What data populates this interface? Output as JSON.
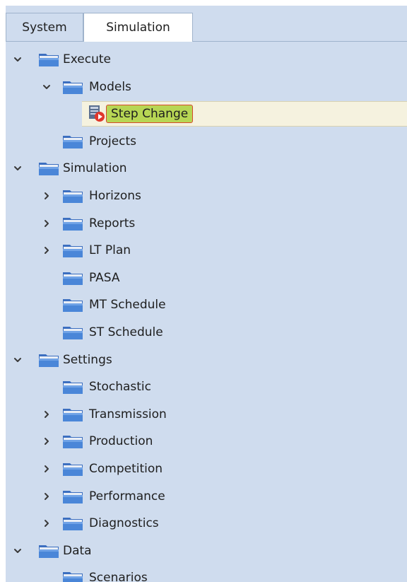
{
  "tabs": [
    {
      "label": "System",
      "active": false
    },
    {
      "label": "Simulation",
      "active": true
    }
  ],
  "tree": [
    {
      "label": "Execute",
      "level": 0,
      "expander": "expanded"
    },
    {
      "label": "Models",
      "level": 1,
      "expander": "expanded"
    },
    {
      "label": "Step Change",
      "level": 2,
      "expander": "none",
      "icon": "model-run-icon",
      "selected": true
    },
    {
      "label": "Projects",
      "level": 1,
      "expander": "none"
    },
    {
      "label": "Simulation",
      "level": 0,
      "expander": "expanded"
    },
    {
      "label": "Horizons",
      "level": 1,
      "expander": "collapsed"
    },
    {
      "label": "Reports",
      "level": 1,
      "expander": "collapsed"
    },
    {
      "label": "LT Plan",
      "level": 1,
      "expander": "collapsed"
    },
    {
      "label": "PASA",
      "level": 1,
      "expander": "none"
    },
    {
      "label": "MT Schedule",
      "level": 1,
      "expander": "none"
    },
    {
      "label": "ST Schedule",
      "level": 1,
      "expander": "none"
    },
    {
      "label": "Settings",
      "level": 0,
      "expander": "expanded"
    },
    {
      "label": "Stochastic",
      "level": 1,
      "expander": "none"
    },
    {
      "label": "Transmission",
      "level": 1,
      "expander": "collapsed"
    },
    {
      "label": "Production",
      "level": 1,
      "expander": "collapsed"
    },
    {
      "label": "Competition",
      "level": 1,
      "expander": "collapsed"
    },
    {
      "label": "Performance",
      "level": 1,
      "expander": "collapsed"
    },
    {
      "label": "Diagnostics",
      "level": 1,
      "expander": "collapsed"
    },
    {
      "label": "Data",
      "level": 0,
      "expander": "expanded"
    },
    {
      "label": "Scenarios",
      "level": 1,
      "expander": "none"
    }
  ],
  "colors": {
    "panel_bg": "#cfdcee",
    "folder_main": "#4a7fd0",
    "selection_highlight": "#b7d654",
    "selection_border": "#d64a2d"
  }
}
